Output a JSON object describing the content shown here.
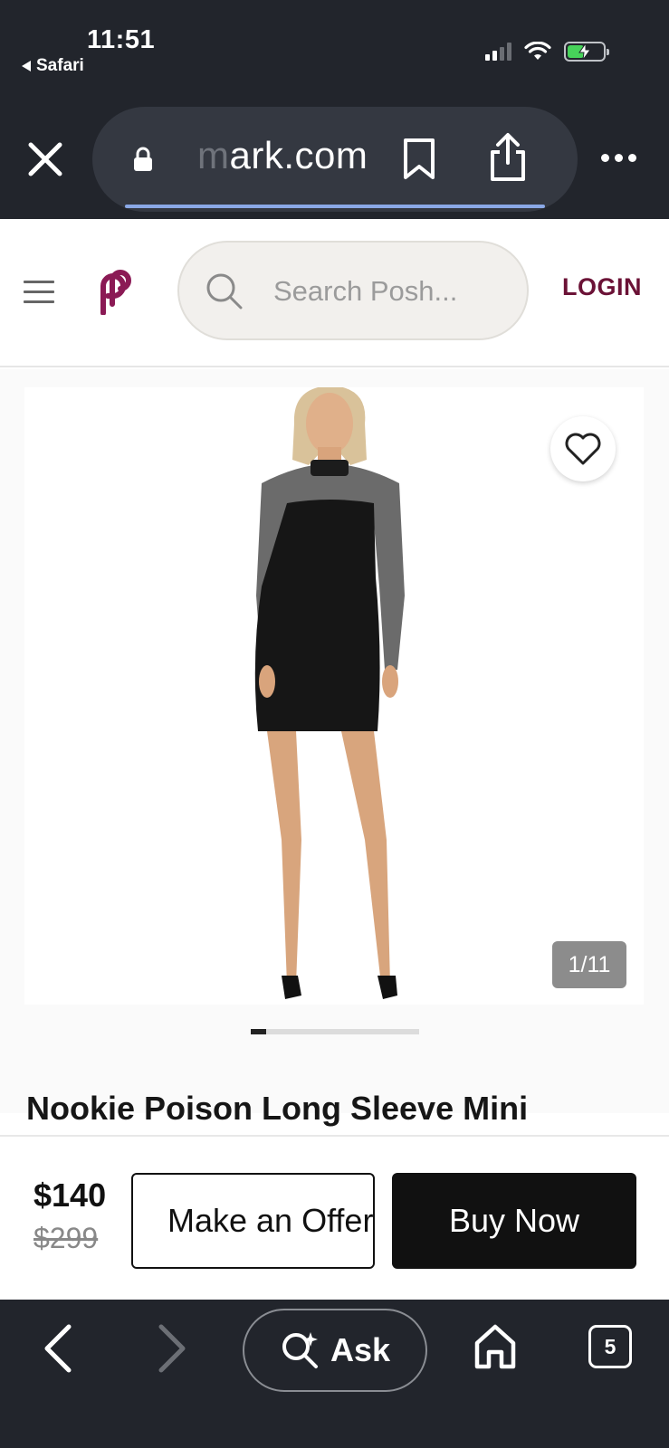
{
  "status_bar": {
    "time": "11:51",
    "back_app": "Safari"
  },
  "browser": {
    "url_faded": "m",
    "url": "ark.com",
    "ask_label": "Ask",
    "tab_count": "5"
  },
  "header": {
    "search_placeholder": "Search Posh...",
    "login_label": "LOGIN"
  },
  "product": {
    "image_alt": "Black long sleeve mini dress",
    "image_counter": "1/11",
    "gallery_progress": 0.09,
    "title": "Nookie Poison Long Sleeve Mini",
    "price": "$140",
    "original_price": "$299",
    "offer_label": "Make an Offer",
    "buy_label": "Buy Now"
  },
  "colors": {
    "brand": "#6b1236",
    "chrome": "#22252c",
    "accent_underline": "#8aa8e6"
  }
}
